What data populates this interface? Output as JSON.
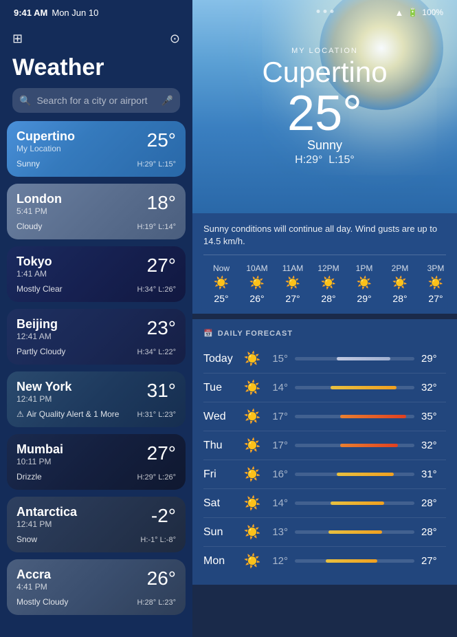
{
  "statusBar": {
    "time": "9:41 AM",
    "date": "Mon Jun 10",
    "wifi": "100%"
  },
  "leftPanel": {
    "title": "Weather",
    "search": {
      "placeholder": "Search for a city or airport"
    },
    "cities": [
      {
        "id": "cupertino",
        "name": "Cupertino",
        "subtitle": "My Location",
        "time": "",
        "temp": "25°",
        "condition": "Sunny",
        "conditionIcon": "☀️",
        "high": "H:29°",
        "low": "L:15°",
        "alert": ""
      },
      {
        "id": "london",
        "name": "London",
        "subtitle": "",
        "time": "5:41 PM",
        "temp": "18°",
        "condition": "Cloudy",
        "conditionIcon": "☁️",
        "high": "H:19°",
        "low": "L:14°",
        "alert": ""
      },
      {
        "id": "tokyo",
        "name": "Tokyo",
        "subtitle": "",
        "time": "1:41 AM",
        "temp": "27°",
        "condition": "Mostly Clear",
        "conditionIcon": "🌙",
        "high": "H:34°",
        "low": "L:26°",
        "alert": ""
      },
      {
        "id": "beijing",
        "name": "Beijing",
        "subtitle": "",
        "time": "12:41 AM",
        "temp": "23°",
        "condition": "Partly Cloudy",
        "conditionIcon": "⛅",
        "high": "H:34°",
        "low": "L:22°",
        "alert": ""
      },
      {
        "id": "newyork",
        "name": "New York",
        "subtitle": "",
        "time": "12:41 PM",
        "temp": "31°",
        "condition": "Air Quality Alert & 1 More",
        "conditionIcon": "⚠",
        "high": "H:31°",
        "low": "L:23°",
        "alert": true
      },
      {
        "id": "mumbai",
        "name": "Mumbai",
        "subtitle": "",
        "time": "10:11 PM",
        "temp": "27°",
        "condition": "Drizzle",
        "conditionIcon": "🌧",
        "high": "H:29°",
        "low": "L:26°",
        "alert": ""
      },
      {
        "id": "antarctica",
        "name": "Antarctica",
        "subtitle": "",
        "time": "12:41 PM",
        "temp": "-2°",
        "condition": "Snow",
        "conditionIcon": "🌨",
        "high": "H:-1°",
        "low": "L:-8°",
        "alert": ""
      },
      {
        "id": "accra",
        "name": "Accra",
        "subtitle": "",
        "time": "4:41 PM",
        "temp": "26°",
        "condition": "Mostly Cloudy",
        "conditionIcon": "⛅",
        "high": "H:28°",
        "low": "L:23°",
        "alert": ""
      }
    ]
  },
  "rightPanel": {
    "hero": {
      "locationLabel": "MY LOCATION",
      "city": "Cupertino",
      "temp": "25°",
      "condition": "Sunny",
      "high": "H:29°",
      "low": "L:15°"
    },
    "hourly": {
      "description": "Sunny conditions will continue all day. Wind gusts are up to 14.5 km/h.",
      "items": [
        {
          "time": "Now",
          "icon": "☀️",
          "temp": "25°"
        },
        {
          "time": "10AM",
          "icon": "☀️",
          "temp": "26°"
        },
        {
          "time": "11AM",
          "icon": "☀️",
          "temp": "27°"
        },
        {
          "time": "12PM",
          "icon": "☀️",
          "temp": "28°"
        },
        {
          "time": "1PM",
          "icon": "☀️",
          "temp": "29°"
        },
        {
          "time": "2PM",
          "icon": "☀️",
          "temp": "28°"
        },
        {
          "time": "3PM",
          "icon": "☀️",
          "temp": "27°"
        }
      ]
    },
    "daily": {
      "label": "DAILY FORECAST",
      "calendarIcon": "📅",
      "rows": [
        {
          "day": "Today",
          "icon": "☀️",
          "low": "15°",
          "high": "29°",
          "barLeft": "35%",
          "barWidth": "45%",
          "barColor": "bar-blue"
        },
        {
          "day": "Tue",
          "icon": "☀️",
          "low": "14°",
          "high": "32°",
          "barLeft": "30%",
          "barWidth": "55%",
          "barColor": "bar-yellow"
        },
        {
          "day": "Wed",
          "icon": "☀️",
          "low": "17°",
          "high": "35°",
          "barLeft": "38%",
          "barWidth": "55%",
          "barColor": "bar-orange"
        },
        {
          "day": "Thu",
          "icon": "☀️",
          "low": "17°",
          "high": "32°",
          "barLeft": "38%",
          "barWidth": "48%",
          "barColor": "bar-orange"
        },
        {
          "day": "Fri",
          "icon": "☀️",
          "low": "16°",
          "high": "31°",
          "barLeft": "35%",
          "barWidth": "48%",
          "barColor": "bar-yellow"
        },
        {
          "day": "Sat",
          "icon": "☀️",
          "low": "14°",
          "high": "28°",
          "barLeft": "30%",
          "barWidth": "45%",
          "barColor": "bar-yellow"
        },
        {
          "day": "Sun",
          "icon": "☀️",
          "low": "13°",
          "high": "28°",
          "barLeft": "28%",
          "barWidth": "45%",
          "barColor": "bar-yellow"
        },
        {
          "day": "Mon",
          "icon": "☀️",
          "low": "12°",
          "high": "27°",
          "barLeft": "26%",
          "barWidth": "43%",
          "barColor": "bar-yellow"
        }
      ]
    }
  }
}
